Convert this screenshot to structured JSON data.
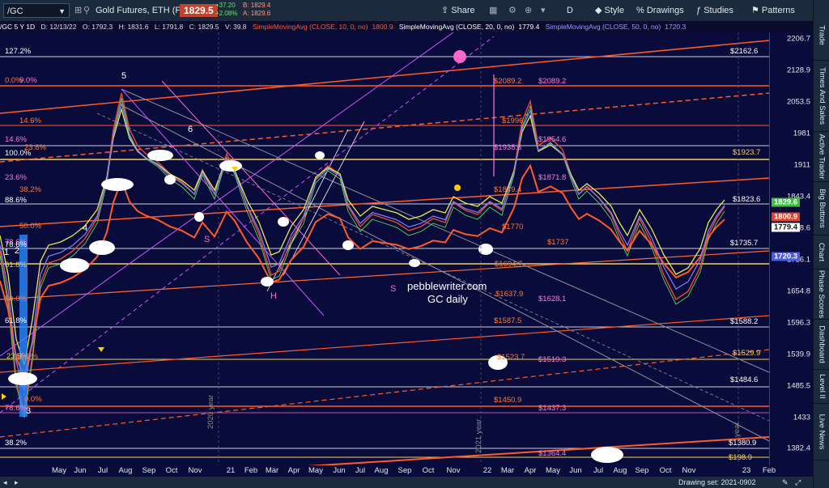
{
  "toolbar": {
    "symbol": "/GC",
    "description": "Gold Futures, ETH (FEB 23)",
    "last_price": "1829.5",
    "change": "+37.20",
    "change_pct": "+2.08%",
    "bid": "B: 1829.4",
    "ask": "A: 1829.6",
    "share": "Share",
    "period": "D",
    "style": "Style",
    "drawings": "Drawings",
    "studies": "Studies",
    "patterns": "Patterns"
  },
  "info": {
    "symbol_period": "/GC 5 Y 1D",
    "date": "D: 12/13/22",
    "open": "O: 1792.3",
    "high": "H: 1831.6",
    "low": "L: 1791.8",
    "close": "C: 1829.5",
    "volume": "V: 39.8",
    "sma10": "SimpleMovingAvg (CLOSE, 10, 0, no)",
    "sma10_val": "1800.9",
    "sma20": "SimpleMovingAvg (CLOSE, 20, 0, no)",
    "sma20_val": "1779.4",
    "sma50": "SimpleMovingAvg (CLOSE, 50, 0, no)",
    "sma50_val": "1720.3"
  },
  "colors": {
    "background": "#090c3a",
    "price_up": "#5cd65c",
    "price_down": "#e0432b",
    "sma10": "#ff4a2a",
    "sma20": "#e8e850",
    "sma50": "#7d7dff",
    "fib": "#ff7a3a",
    "magenta": "#ff66cc"
  },
  "y_axis": [
    "2206.7",
    "2128.9",
    "2053.5",
    "1981",
    "1911",
    "1843.4",
    "1778.6",
    "1716.1",
    "1654.8",
    "1596.3",
    "1539.9",
    "1485.5",
    "1433",
    "1382.4"
  ],
  "y_badges": {
    "last": "1829.6",
    "sma10": "1800.9",
    "sma20": "1779.4",
    "sma50": "1720.3"
  },
  "x_axis": [
    "May",
    "Jun",
    "Jul",
    "Aug",
    "Sep",
    "Oct",
    "Nov",
    "21",
    "Feb",
    "Mar",
    "Apr",
    "May",
    "Jun",
    "Jul",
    "Aug",
    "Sep",
    "Oct",
    "Nov",
    "22",
    "Mar",
    "Apr",
    "May",
    "Jun",
    "Jul",
    "Aug",
    "Sep",
    "Oct",
    "Nov",
    "23",
    "Feb"
  ],
  "level_labels_right": [
    "$2162.6",
    "$1923.7",
    "$1823.6",
    "$1735.7",
    "$1588.2",
    "$1529.9",
    "$1484.6",
    "$1380.9",
    "$198.9"
  ],
  "level_labels_mid": [
    "$2089.2",
    "$2089.2",
    "$1996",
    "$1954.6",
    "$1938.6",
    "$1871.8",
    "$1849.4",
    "$1770",
    "$1737",
    "$1694.7",
    "$1637.9",
    "$1628.1",
    "$1587.5",
    "$1523.7",
    "$1519.3",
    "$1450.9",
    "$1437.3",
    "$1364.4"
  ],
  "fib_labels_left": [
    "127.2%",
    "0.0%",
    "9.0%",
    "14.6%",
    "14.6%",
    "23.6%",
    "100.0%",
    "23.6%",
    "38.2%",
    "88.6%",
    "50.0%",
    "78.6%",
    "78.6%",
    "61.8%",
    "50.0%",
    "61.8%",
    "23.6%",
    "50.0%",
    "78.6%",
    "38.2%",
    "0.0%"
  ],
  "wave_labels": [
    "5",
    "6",
    "4",
    "1",
    "2",
    "3",
    "S",
    "S",
    "H"
  ],
  "watermark": "pebblewriter.com",
  "watermark_sub": "GC daily",
  "year_labels": [
    "2020 year",
    "2021 year",
    "year"
  ],
  "status": {
    "left": "",
    "right": "Drawing set: 2021-0902"
  },
  "right_tabs": [
    "Trade",
    "Times And Sales",
    "Active Trader",
    "Big Buttons",
    "Chart",
    "Phase Scores",
    "Dashboard",
    "Level II",
    "Live News"
  ]
}
